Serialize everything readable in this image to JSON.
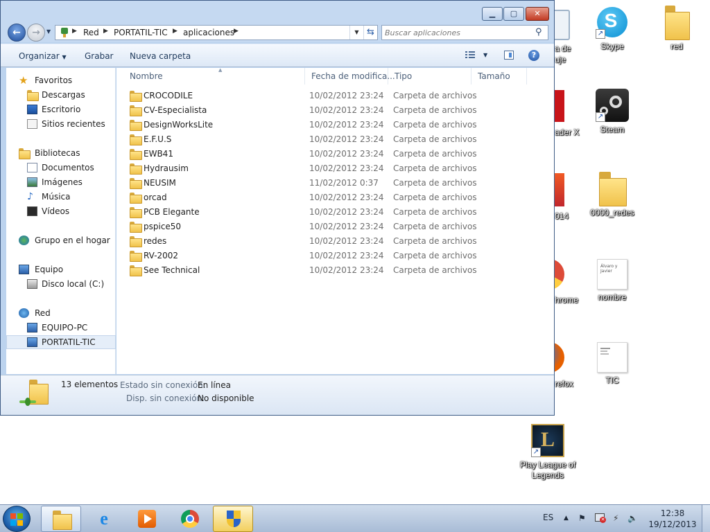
{
  "window": {
    "breadcrumb": [
      "Red",
      "PORTATIL-TIC",
      "aplicaciones"
    ],
    "search_placeholder": "Buscar aplicaciones",
    "toolbar": {
      "organize": "Organizar",
      "burn": "Grabar",
      "new_folder": "Nueva carpeta"
    },
    "nav": {
      "favorites": "Favoritos",
      "favorites_items": [
        "Descargas",
        "Escritorio",
        "Sitios recientes"
      ],
      "libraries": "Bibliotecas",
      "libraries_items": [
        "Documentos",
        "Imágenes",
        "Música",
        "Vídeos"
      ],
      "homegroup": "Grupo en el hogar",
      "computer": "Equipo",
      "computer_items": [
        "Disco local (C:)"
      ],
      "network": "Red",
      "network_items": [
        "EQUIPO-PC",
        "PORTATIL-TIC"
      ]
    },
    "columns": [
      "Nombre",
      "Fecha de modifica...",
      "Tipo",
      "Tamaño"
    ],
    "files": [
      {
        "name": "CROCODILE",
        "date": "10/02/2012 23:24",
        "type": "Carpeta de archivos"
      },
      {
        "name": "CV-Especialista",
        "date": "10/02/2012 23:24",
        "type": "Carpeta de archivos"
      },
      {
        "name": "DesignWorksLite",
        "date": "10/02/2012 23:24",
        "type": "Carpeta de archivos"
      },
      {
        "name": "E.F.U.S",
        "date": "10/02/2012 23:24",
        "type": "Carpeta de archivos"
      },
      {
        "name": "EWB41",
        "date": "10/02/2012 23:24",
        "type": "Carpeta de archivos"
      },
      {
        "name": "Hydrausim",
        "date": "10/02/2012 23:24",
        "type": "Carpeta de archivos"
      },
      {
        "name": "NEUSIM",
        "date": "11/02/2012 0:37",
        "type": "Carpeta de archivos"
      },
      {
        "name": "orcad",
        "date": "10/02/2012 23:24",
        "type": "Carpeta de archivos"
      },
      {
        "name": "PCB Elegante",
        "date": "10/02/2012 23:24",
        "type": "Carpeta de archivos"
      },
      {
        "name": "pspice50",
        "date": "10/02/2012 23:24",
        "type": "Carpeta de archivos"
      },
      {
        "name": "redes",
        "date": "10/02/2012 23:24",
        "type": "Carpeta de archivos"
      },
      {
        "name": "RV-2002",
        "date": "10/02/2012 23:24",
        "type": "Carpeta de archivos"
      },
      {
        "name": "See Technical",
        "date": "10/02/2012 23:24",
        "type": "Carpeta de archivos"
      }
    ],
    "details": {
      "count": "13 elementos",
      "offline_status_label": "Estado sin conexión:",
      "offline_status_value": "En línea",
      "offline_avail_label": "Disp. sin conexión:",
      "offline_avail_value": "No disponible"
    }
  },
  "desktop": {
    "icons": [
      {
        "label": "Skype"
      },
      {
        "label": "red"
      },
      {
        "label": "Steam"
      },
      {
        "label": "0000_redes"
      },
      {
        "label": "nombre",
        "preview_text": "Álvaro y Javier"
      },
      {
        "label": "TIC"
      },
      {
        "label": "Play League of Legends"
      }
    ],
    "clipped_labels": [
      "a de",
      "uje",
      "ader X",
      "014",
      "hrome",
      "refox"
    ]
  },
  "taskbar": {
    "language": "ES",
    "time": "12:38",
    "date": "19/12/2013"
  },
  "colors": {
    "window_frame": "#bcd3ee",
    "selection": "#e5eef9",
    "folder": "#f0c24b",
    "taskbar": "#b9cae0"
  }
}
